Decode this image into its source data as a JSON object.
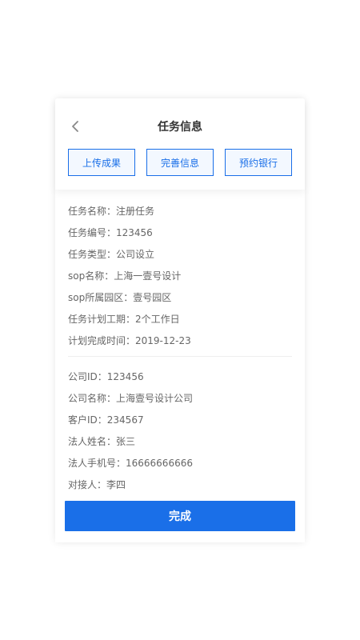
{
  "header": {
    "title": "任务信息",
    "buttons": [
      "上传成果",
      "完善信息",
      "预约银行"
    ]
  },
  "task_info": [
    "任务名称：注册任务",
    "任务编号：123456",
    "任务类型：公司设立",
    "sop名称：上海一壹号设计",
    "sop所属园区：壹号园区",
    "任务计划工期：2个工作日",
    "计划完成时间：2019-12-23"
  ],
  "company_info": [
    "公司ID：123456",
    "公司名称：上海壹号设计公司",
    "客户ID：234567",
    "法人姓名：张三",
    "法人手机号：16666666666",
    "对接人：李四"
  ],
  "finish_label": "完成",
  "colors": {
    "accent": "#1a6fe8",
    "text": "#666666",
    "title": "#333333"
  }
}
